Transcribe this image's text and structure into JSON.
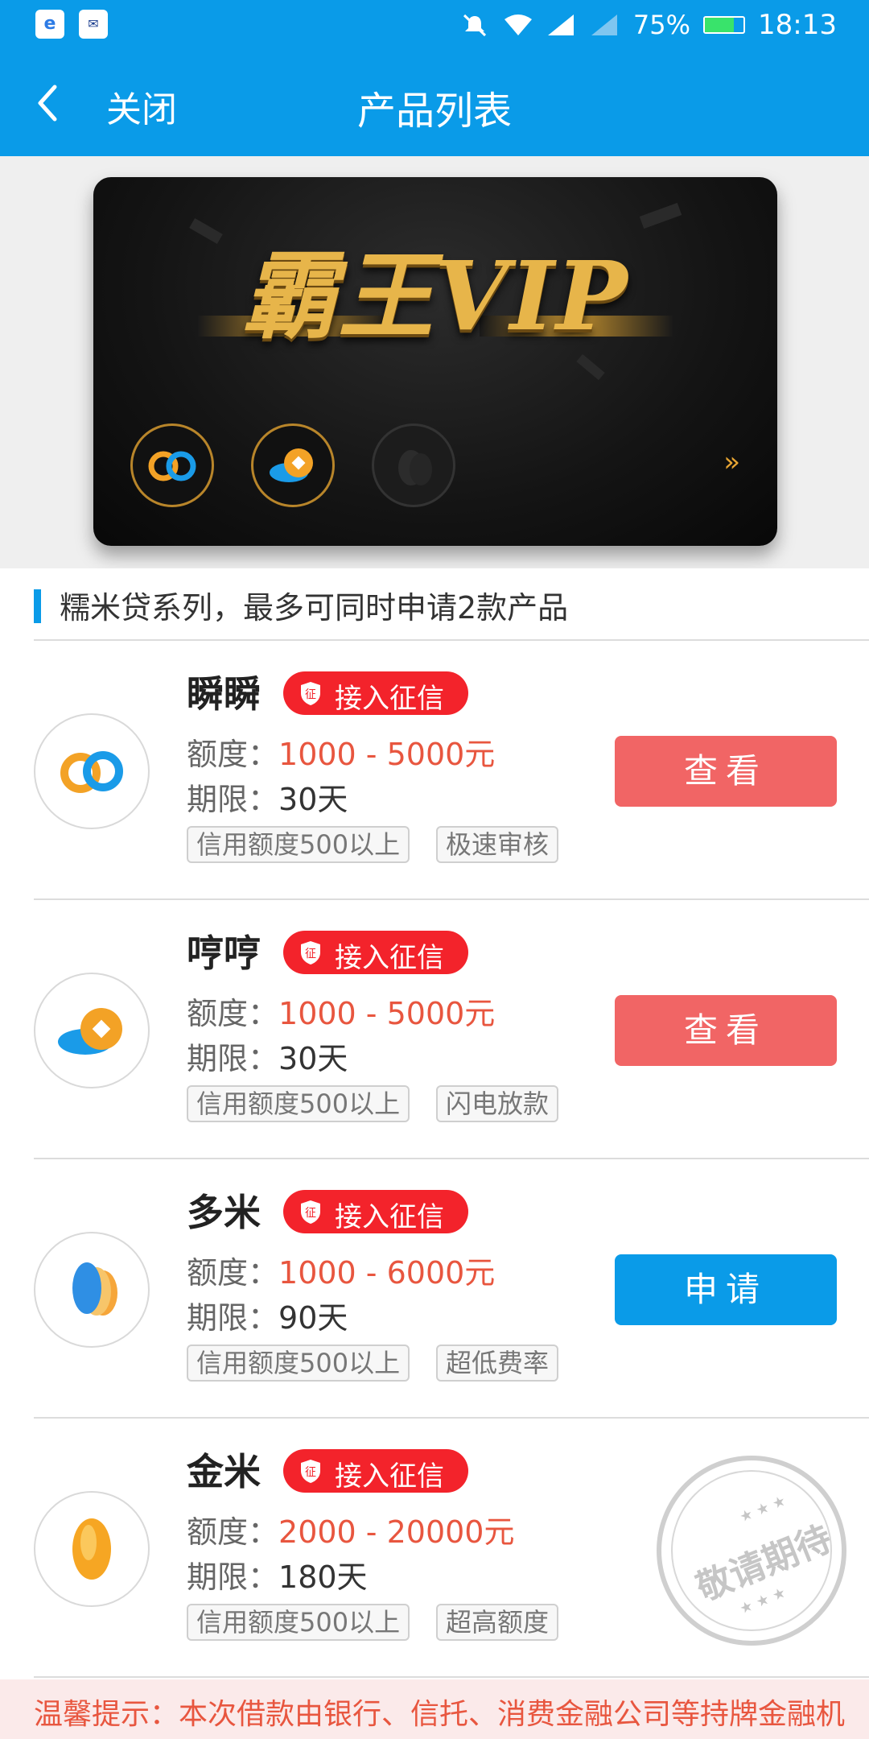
{
  "status_bar": {
    "battery": "75%",
    "time": "18:13",
    "battery_fill_fraction": 0.75
  },
  "header": {
    "back_label": "关闭",
    "title": "产品列表"
  },
  "banner": {
    "title": "霸王VIP",
    "more": "»"
  },
  "section": {
    "title": "糯米贷系列，最多可同时申请2款产品"
  },
  "labels": {
    "amount_prefix": "额度：",
    "term_prefix": "期限：",
    "credit_badge": "接入征信",
    "badge_icon_char": "征"
  },
  "products": [
    {
      "name": "瞬瞬",
      "amount": "1000 - 5000元",
      "term": "30天",
      "tags": [
        "信用额度500以上",
        "极速审核"
      ],
      "button": "查看",
      "button_color": "#f16565"
    },
    {
      "name": "哼哼",
      "amount": "1000 - 5000元",
      "term": "30天",
      "tags": [
        "信用额度500以上",
        "闪电放款"
      ],
      "button": "查看",
      "button_color": "#f16565"
    },
    {
      "name": "多米",
      "amount": "1000 - 6000元",
      "term": "90天",
      "tags": [
        "信用额度500以上",
        "超低费率"
      ],
      "button": "申请",
      "button_color": "#0a9be8"
    },
    {
      "name": "金米",
      "amount": "2000 - 20000元",
      "term": "180天",
      "tags": [
        "信用额度500以上",
        "超高额度"
      ],
      "stamp": "敬请期待"
    }
  ],
  "notice": {
    "text": "温馨提示：本次借款由银行、信托、消费金融公司等持牌金融机"
  },
  "colors": {
    "primary": "#0a9be8",
    "badge_red": "#f3232b",
    "amount_orange": "#e8563f",
    "button_red": "#f16565"
  }
}
